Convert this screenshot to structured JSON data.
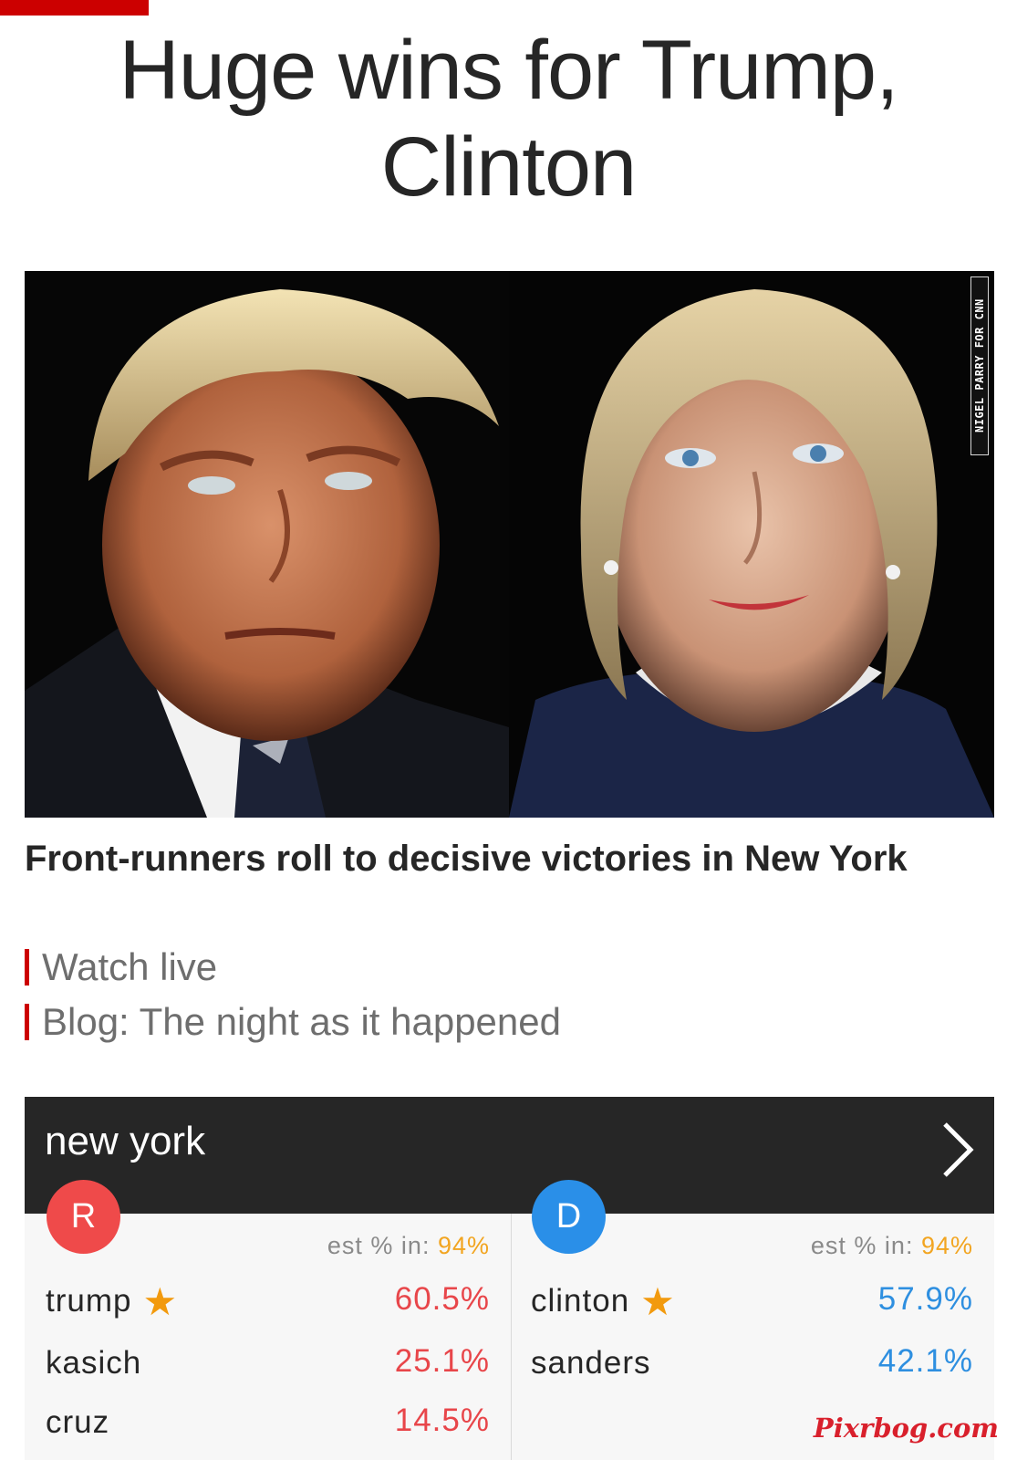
{
  "headline": {
    "line1": "Huge wins for Trump,",
    "line2": "Clinton"
  },
  "hero": {
    "photo_credit": "NIGEL PARRY FOR CNN"
  },
  "story": {
    "title": "Front-runners roll to decisive victories in New York",
    "links": [
      "Watch live",
      "Blog: The night as it happened"
    ]
  },
  "results": {
    "state": "new york",
    "republican": {
      "badge": "R",
      "est_label": "est % in: ",
      "est_value": "94%",
      "candidates": [
        {
          "name": "trump",
          "winner": true,
          "pct": "60.5%"
        },
        {
          "name": "kasich",
          "winner": false,
          "pct": "25.1%"
        },
        {
          "name": "cruz",
          "winner": false,
          "pct": "14.5%"
        }
      ]
    },
    "democratic": {
      "badge": "D",
      "est_label": "est % in: ",
      "est_value": "94%",
      "candidates": [
        {
          "name": "clinton",
          "winner": true,
          "pct": "57.9%"
        },
        {
          "name": "sanders",
          "winner": false,
          "pct": "42.1%"
        }
      ]
    },
    "winner_star": "★"
  },
  "watermark": "Pixrbog.com",
  "colors": {
    "accent_red": "#cc0000",
    "republican": "#ef4a4a",
    "democratic": "#2a8fe8",
    "est_orange": "#f2a521",
    "star": "#f29a0e"
  },
  "icons": {
    "results_chevron": "chevron-right-icon",
    "winner": "star-icon"
  }
}
